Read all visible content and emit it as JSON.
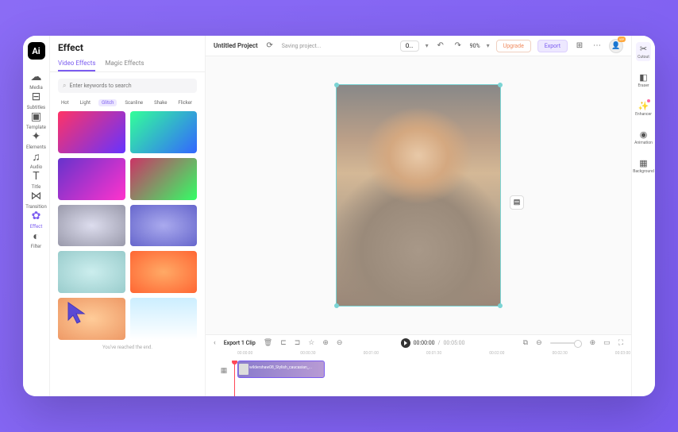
{
  "sidebar": {
    "items": [
      {
        "label": "Media",
        "icon": "☁"
      },
      {
        "label": "Subtitles",
        "icon": "⊟"
      },
      {
        "label": "Template",
        "icon": "▣"
      },
      {
        "label": "Elements",
        "icon": "✦"
      },
      {
        "label": "Audio",
        "icon": "♫"
      },
      {
        "label": "Title",
        "icon": "T"
      },
      {
        "label": "Transition",
        "icon": "⋈"
      },
      {
        "label": "Effect",
        "icon": "✿"
      },
      {
        "label": "Filter",
        "icon": "◐"
      }
    ],
    "active_index": 7
  },
  "panel": {
    "title": "Effect",
    "tabs": [
      "Video Effects",
      "Magic Effects"
    ],
    "active_tab": 0,
    "search_placeholder": "Enter keywords to search",
    "filters": [
      "Hot",
      "Light",
      "Glitch",
      "Scanline",
      "Shake",
      "Flicker"
    ],
    "active_filter": 2,
    "end_message": "You've reached the end."
  },
  "header": {
    "project_name": "Untitled Project",
    "saving_text": "Saving project...",
    "ratio": "O...",
    "zoom": "90%",
    "upgrade": "Upgrade",
    "export": "Export"
  },
  "right_tools": {
    "items": [
      {
        "label": "Cutout",
        "icon": "✂"
      },
      {
        "label": "Eraser",
        "icon": "◧"
      },
      {
        "label": "Enhancer",
        "icon": "✨",
        "badge": true
      },
      {
        "label": "Animation",
        "icon": "◉"
      },
      {
        "label": "Background",
        "icon": "▦"
      }
    ],
    "active_index": 0
  },
  "timeline": {
    "title": "Export 1 Clip",
    "current": "00:00:00",
    "total": "00:05:00",
    "ticks": [
      "00:00:00",
      "00:00:30",
      "00:01:00",
      "00:01:30",
      "00:02:00",
      "00:02:30",
      "00:03:00"
    ],
    "clip_name": "wildershaw08_Stylish_caucasian_..."
  },
  "colors": {
    "accent": "#7b5cf0",
    "gradient_bg": "#8b6cf5"
  }
}
